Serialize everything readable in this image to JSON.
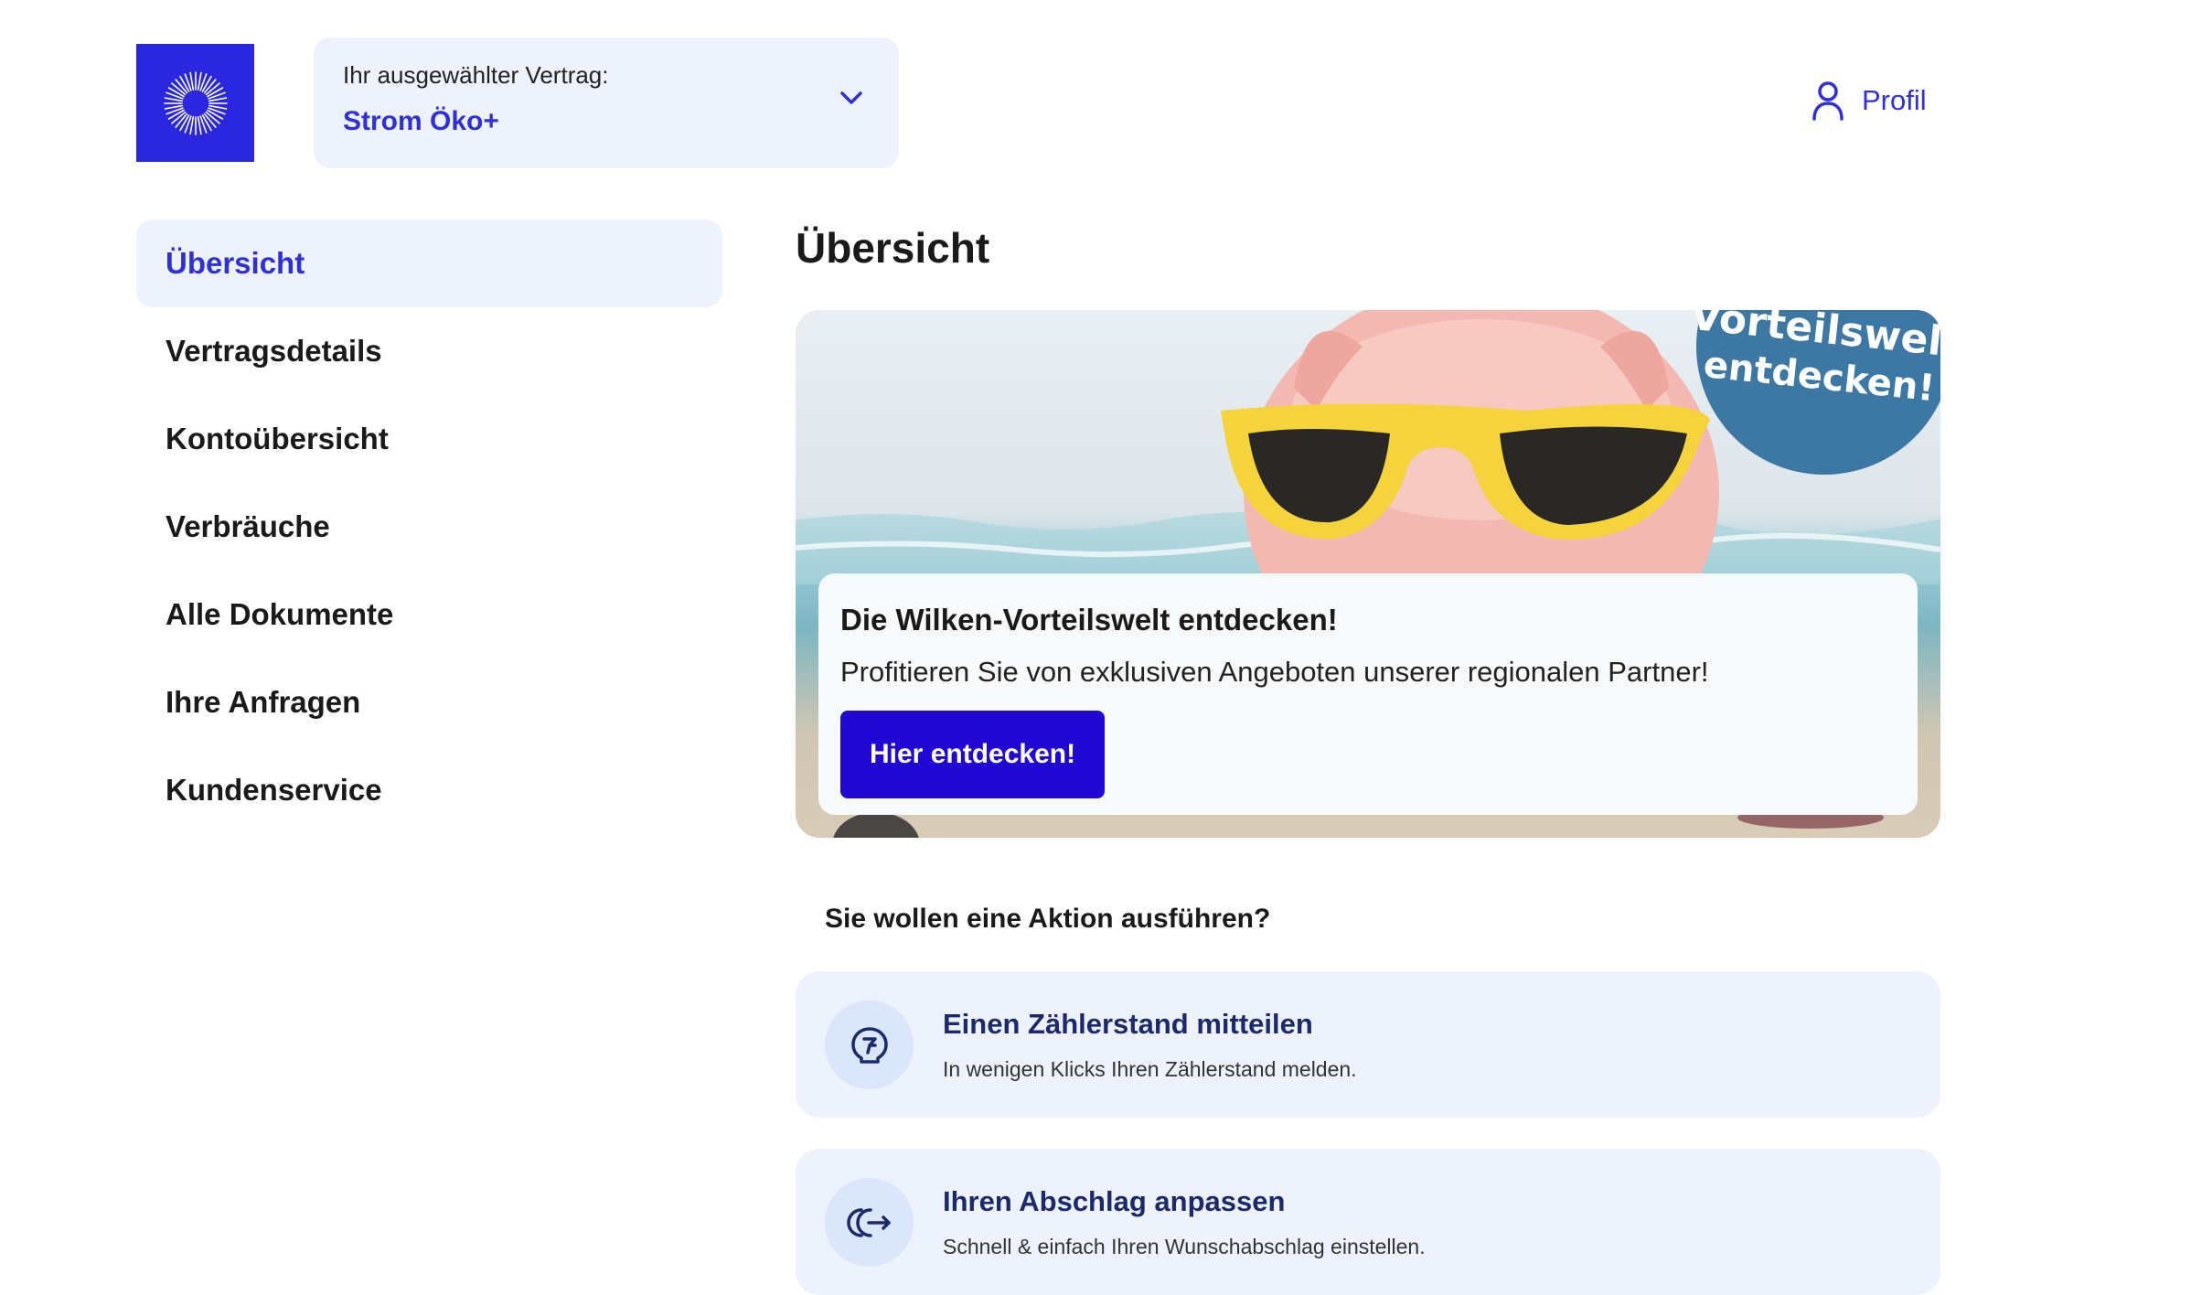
{
  "header": {
    "contract_label": "Ihr ausgewählter Vertrag:",
    "contract_value": "Strom Öko+",
    "profile_label": "Profil"
  },
  "sidebar": {
    "items": [
      {
        "label": "Übersicht",
        "active": true
      },
      {
        "label": "Vertragsdetails"
      },
      {
        "label": "Kontoübersicht"
      },
      {
        "label": "Verbräuche"
      },
      {
        "label": "Alle Dokumente"
      },
      {
        "label": "Ihre Anfragen"
      },
      {
        "label": "Kundenservice"
      }
    ]
  },
  "main": {
    "title": "Übersicht",
    "banner": {
      "badge_text_1": "Vorteilswelt",
      "badge_text_2": "entdecken!",
      "title": "Die Wilken-Vorteilswelt entdecken!",
      "text": "Profitieren Sie von exklusiven Angeboten unserer regionalen Partner!",
      "button": "Hier entdecken!"
    },
    "actions_title": "Sie wollen eine Aktion ausführen?",
    "actions": [
      {
        "title": "Einen Zählerstand mitteilen",
        "subtitle": "In wenigen Klicks Ihren Zählerstand melden.",
        "icon": "meter-icon"
      },
      {
        "title": "Ihren Abschlag anpassen",
        "subtitle": "Schnell & einfach Ihren Wunschabschlag einstellen.",
        "icon": "exchange-icon"
      }
    ]
  },
  "colors": {
    "brand": "#2b27e0",
    "accent": "#2f31d6",
    "button": "#2007d4",
    "light_bg": "#edf2fd"
  }
}
